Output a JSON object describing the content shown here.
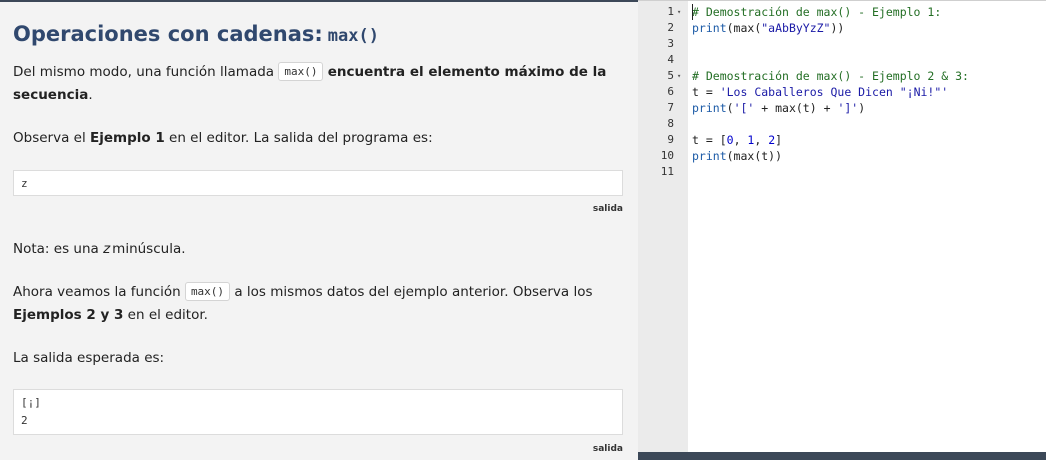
{
  "lesson": {
    "title_text": "Operaciones con cadenas:",
    "title_code": "max()",
    "p1_pre": "Del mismo modo, una función llamada",
    "p1_code": "max()",
    "p1_bold": "encuentra el elemento máximo de la secuencia",
    "p1_post": ".",
    "p2_pre": "Observa el",
    "p2_bold": "Ejemplo 1",
    "p2_post": "en el editor. La salida del programa es:",
    "output1": [
      "z"
    ],
    "output_label": "salida",
    "note_pre": "Nota: es una",
    "note_em": "z",
    "note_post": "minúscula.",
    "p3_pre": "Ahora veamos la función",
    "p3_code": "max()",
    "p3_mid": "a los mismos datos del ejemplo anterior. Observa los",
    "p3_bold": "Ejemplos 2 y 3",
    "p3_post": "en el editor.",
    "p4": "La salida esperada es:",
    "output2": [
      "[¡]",
      "2"
    ]
  },
  "editor": {
    "lines": [
      {
        "num": "1",
        "fold": true
      },
      {
        "num": "2",
        "fold": false
      },
      {
        "num": "3",
        "fold": false
      },
      {
        "num": "4",
        "fold": false
      },
      {
        "num": "5",
        "fold": true
      },
      {
        "num": "6",
        "fold": false
      },
      {
        "num": "7",
        "fold": false
      },
      {
        "num": "8",
        "fold": false
      },
      {
        "num": "9",
        "fold": false
      },
      {
        "num": "10",
        "fold": false
      },
      {
        "num": "11",
        "fold": false
      }
    ],
    "code": {
      "l1": "# Demostración de max() - Ejemplo 1:",
      "l2_kw": "print",
      "l2_a": "(max(",
      "l2_str": "\"aAbByYzZ\"",
      "l2_b": "))",
      "l5": "# Demostración de max() - Ejemplo 2 & 3:",
      "l6_a": "t = ",
      "l6_str": "'Los Caballeros Que Dicen \"¡Ni!\"'",
      "l7_kw": "print",
      "l7_a": "(",
      "l7_s1": "'['",
      "l7_b": " + max(t) + ",
      "l7_s2": "']'",
      "l7_c": ")",
      "l9_a": "t = [",
      "l9_n1": "0",
      "l9_s1": ", ",
      "l9_n2": "1",
      "l9_s2": ", ",
      "l9_n3": "2",
      "l9_b": "]",
      "l10_kw": "print",
      "l10_a": "(max(t))"
    },
    "fold_glyph": "▾",
    "colors": {
      "comment": "#236e24",
      "keyword": "#1d5ba7",
      "string": "#1a1aa6",
      "number": "#0000cd"
    }
  }
}
